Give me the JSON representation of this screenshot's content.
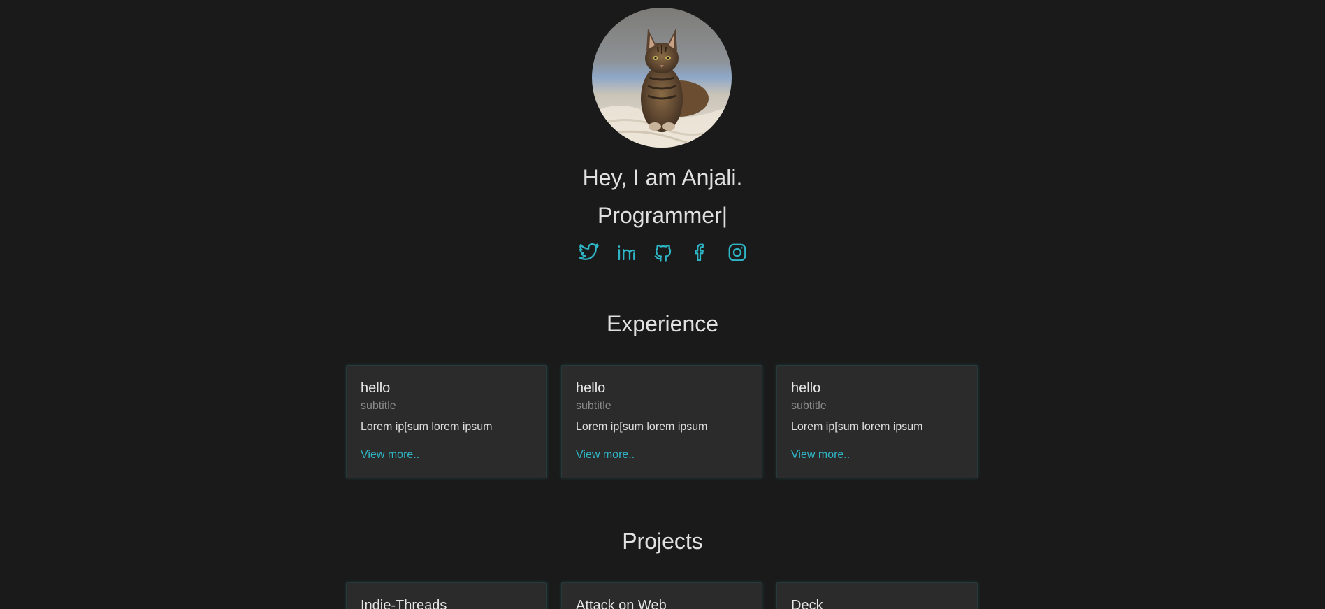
{
  "hero": {
    "greeting": "Hey, I am Anjali.",
    "role": "Programmer",
    "caret": "|",
    "avatar_alt": "cat"
  },
  "socials": [
    {
      "name": "twitter-icon"
    },
    {
      "name": "linkedin-icon"
    },
    {
      "name": "github-icon"
    },
    {
      "name": "facebook-icon"
    },
    {
      "name": "instagram-icon"
    }
  ],
  "experience": {
    "title": "Experience",
    "cards": [
      {
        "title": "hello",
        "subtitle": "subtitle",
        "text": "Lorem ip[sum lorem ipsum",
        "link": "View more.."
      },
      {
        "title": "hello",
        "subtitle": "subtitle",
        "text": "Lorem ip[sum lorem ipsum",
        "link": "View more.."
      },
      {
        "title": "hello",
        "subtitle": "subtitle",
        "text": "Lorem ip[sum lorem ipsum",
        "link": "View more.."
      }
    ]
  },
  "projects": {
    "title": "Projects",
    "cards": [
      {
        "title": "Indie-Threads"
      },
      {
        "title": "Attack on Web"
      },
      {
        "title": "Deck"
      }
    ]
  },
  "colors": {
    "background": "#1a1a1a",
    "card": "#2b2b2b",
    "accent": "#2fb6c6",
    "text": "#e0e0e0",
    "muted": "#8a8a8a"
  }
}
